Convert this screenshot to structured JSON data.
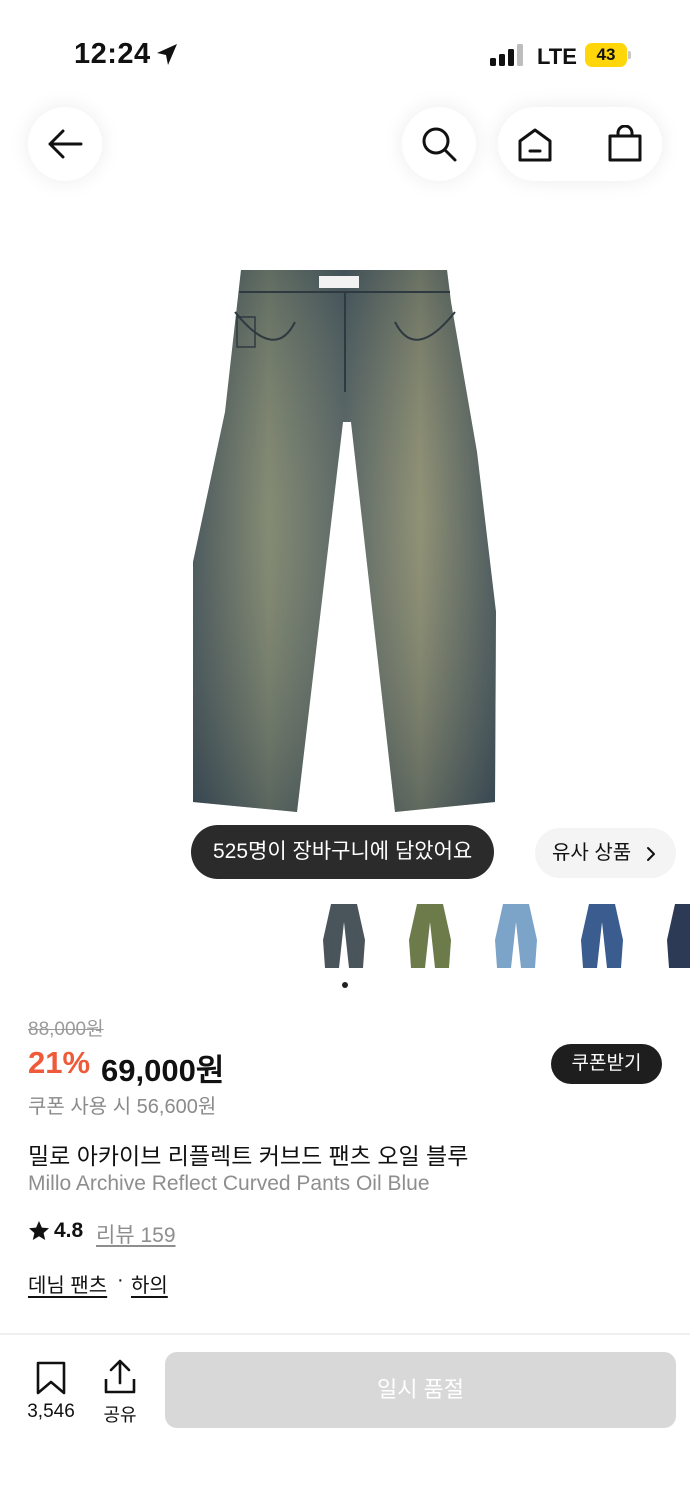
{
  "status_bar": {
    "time": "12:24",
    "network": "LTE",
    "battery": "43",
    "battery_color": "#ffd60a"
  },
  "nav": {
    "back_icon": "arrow-left-icon",
    "search_icon": "search-icon",
    "home_icon": "home-icon",
    "bag_icon": "shopping-bag-icon"
  },
  "product": {
    "cart_badge": "525명이 장바구니에 담았어요",
    "similar_label": "유사 상품",
    "thumbnail_count": 5,
    "original_price": "88,000원",
    "discount": "21%",
    "price": "69,000원",
    "coupon_button": "쿠폰받기",
    "coupon_price": "쿠폰 사용 시 56,600원",
    "title_ko": "밀로 아카이브 리플렉트 커브드 팬츠 오일 블루",
    "title_en": "Millo Archive Reflect Curved Pants Oil Blue",
    "rating": "4.8",
    "review_link": "리뷰 159",
    "category_1": "데님 팬츠",
    "category_sep": "·",
    "category_2": "하의"
  },
  "bottom_bar": {
    "bookmark_count": "3,546",
    "share_label": "공유",
    "soldout_label": "일시 품절"
  },
  "colors": {
    "discount": "#ee5a3a",
    "soldout_button": "#d8d8d8",
    "badge_bg": "#2b2b2b"
  }
}
